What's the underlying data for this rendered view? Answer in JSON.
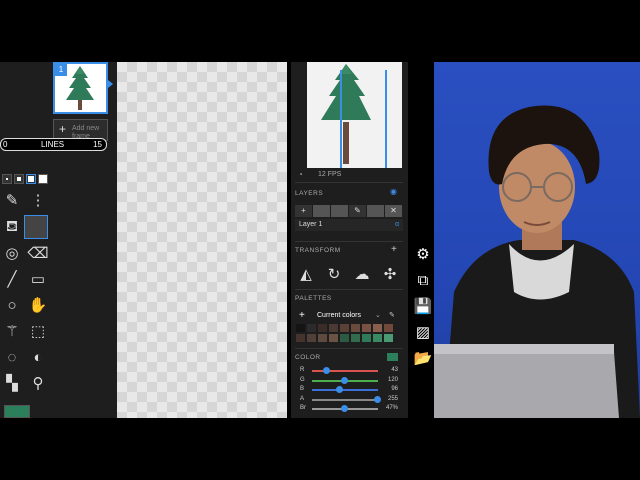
{
  "frames": {
    "current_number": "1",
    "add_label": "Add new frame"
  },
  "lines_bar": {
    "min": "0",
    "label": "LINES",
    "max": "15"
  },
  "preview": {
    "fps": "12 FPS"
  },
  "layers": {
    "title": "LAYERS",
    "items": [
      "Layer 1"
    ],
    "alpha_symbol": "α"
  },
  "transform": {
    "title": "TRANSFORM"
  },
  "palettes": {
    "title": "PALETTES",
    "current": "Current colors",
    "swatches": [
      "#141414",
      "#2b2b2b",
      "#3a2d28",
      "#4a3a33",
      "#5a4037",
      "#6b4a3e",
      "#7a5244",
      "#8a5e4d",
      "#6f4a3b",
      "#44342d",
      "#504038",
      "#5e4a3e",
      "#6c5242",
      "#2d5a44",
      "#336b4f",
      "#2f7a58",
      "#3a8a65",
      "#4a9a74"
    ]
  },
  "color": {
    "title": "COLOR",
    "current_hex": "#2b7f5a",
    "channels": [
      {
        "label": "R",
        "value": "43",
        "fraction": 0.17,
        "track": "#d9534f"
      },
      {
        "label": "G",
        "value": "120",
        "fraction": 0.47,
        "track": "#4cae4c"
      },
      {
        "label": "B",
        "value": "96",
        "fraction": 0.38,
        "track": "#3b6fd8"
      },
      {
        "label": "A",
        "value": "255",
        "fraction": 1.0,
        "track": "#888888"
      },
      {
        "label": "Br",
        "value": "47%",
        "fraction": 0.47,
        "track": "#999999"
      }
    ]
  },
  "colors": {
    "accent": "#3b8ee8",
    "panel_bg": "#1e1e1e",
    "primary_color": "#2b7f5a"
  }
}
